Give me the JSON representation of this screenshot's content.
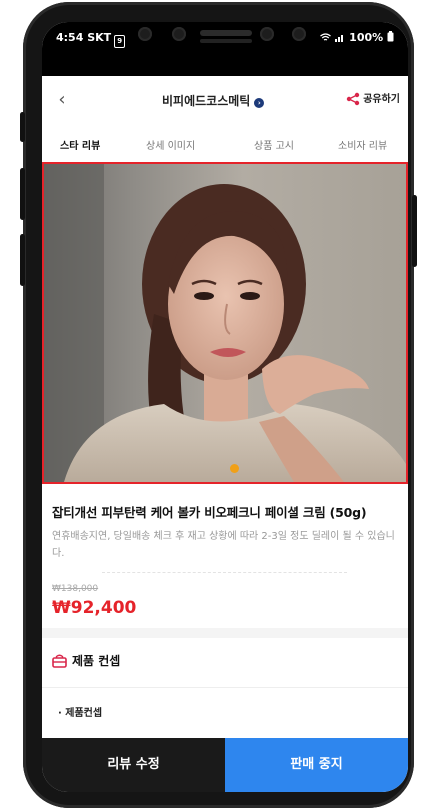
{
  "status_bar": {
    "time": "4:54",
    "carrier": "SKT",
    "sim_badge": "9",
    "battery": "100%"
  },
  "header": {
    "brand": "비피에드코스메틱",
    "share_label": "공유하기",
    "back_icon": "chevron-left-icon",
    "share_icon": "share-icon"
  },
  "tabs": [
    {
      "label": "스타 리뷰",
      "active": true
    },
    {
      "label": "상세 이미지",
      "active": false
    },
    {
      "label": "상품 고시",
      "active": false
    },
    {
      "label": "소비자 리뷰",
      "active": false
    }
  ],
  "product": {
    "title": "잡티개선 피부탄력 케어 볼카 비오페크니 페이셜 크림 (50g)",
    "description": "연휴배송지연, 당일배송 체크 후 재고 상황에 따라 2-3일 정도 딜레이 될 수 있습니다.",
    "original_price": "₩138,000",
    "price": "₩92,400"
  },
  "concept": {
    "heading": "제품 컨셉",
    "item": "제품컨셉"
  },
  "bottom": {
    "review_button": "리뷰 수정",
    "stop_button": "판매 중지"
  },
  "colors": {
    "accent_red": "#e5232a",
    "button_blue": "#2e86ee",
    "button_dark": "#1a1a1a",
    "indicator_orange": "#f0a018"
  }
}
